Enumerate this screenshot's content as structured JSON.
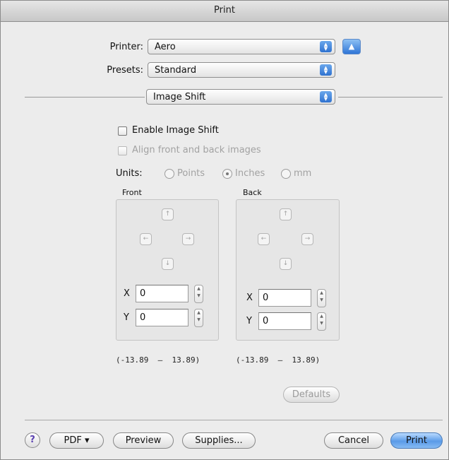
{
  "window": {
    "title": "Print"
  },
  "printer": {
    "label": "Printer:",
    "value": "Aero",
    "expand_icon": "triangle-up-icon"
  },
  "presets": {
    "label": "Presets:",
    "value": "Standard"
  },
  "panel": {
    "value": "Image Shift"
  },
  "options": {
    "enable_shift": {
      "label": "Enable Image Shift",
      "checked": false,
      "enabled": true
    },
    "align_images": {
      "label": "Align front and back images",
      "checked": false,
      "enabled": false
    }
  },
  "units": {
    "label": "Units:",
    "options": [
      {
        "label": "Points",
        "selected": false
      },
      {
        "label": "Inches",
        "selected": true
      },
      {
        "label": "mm",
        "selected": false
      }
    ]
  },
  "front": {
    "title": "Front",
    "x_label": "X",
    "x_value": "0",
    "y_label": "Y",
    "y_value": "0",
    "range": "(-13.89  —  13.89)"
  },
  "back": {
    "title": "Back",
    "x_label": "X",
    "x_value": "0",
    "y_label": "Y",
    "y_value": "0",
    "range": "(-13.89  —  13.89)"
  },
  "arrows": {
    "up": "↑",
    "left": "←",
    "right": "→",
    "down": "↓"
  },
  "defaults_button": "Defaults",
  "footer": {
    "help": "?",
    "pdf": "PDF ▾",
    "preview": "Preview",
    "supplies": "Supplies...",
    "cancel": "Cancel",
    "print": "Print"
  },
  "colors": {
    "default_button": "#5a9be8",
    "window_bg": "#ececec"
  }
}
